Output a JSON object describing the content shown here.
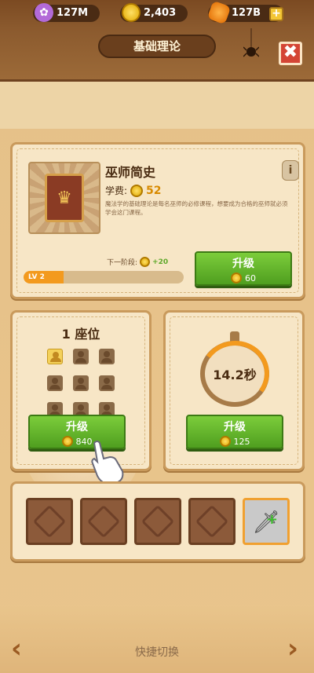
{
  "top_bar": {
    "purple_currency": "127M",
    "gold_currency": "2,403",
    "gem_currency": "127B",
    "plus_label": "+"
  },
  "screen_title": "基础理论",
  "close_label": "✖",
  "course": {
    "name": "巫师简史",
    "info_label": "i",
    "fee_label": "学费:",
    "fee_value": "52",
    "description": "魔法学的基础理论是每名巫师的必修课程，想要成为合格的巫师就必须学会这门课程。",
    "next_stage_label": "下一阶段:",
    "next_stage_value": "+20",
    "level_label": "LV 2",
    "level_progress": 0.25,
    "upgrade_label": "升级",
    "upgrade_cost": "60"
  },
  "seats": {
    "title": "1 座位",
    "slots": [
      true,
      false,
      false,
      false,
      false,
      false,
      false,
      false,
      false
    ],
    "upgrade_label": "升级",
    "upgrade_cost": "840"
  },
  "timer": {
    "value": "14.2秒",
    "upgrade_label": "升级",
    "upgrade_cost": "125"
  },
  "item_slots": {
    "count_empty": 4,
    "weapon_icon": "sword-icon"
  },
  "footer": {
    "quick_switch": "快捷切换",
    "prev_label": "‹",
    "next_label": "›"
  },
  "colors": {
    "accent_green": "#5ea82a",
    "level_orange": "#f39a1e",
    "close_red": "#d44535"
  }
}
